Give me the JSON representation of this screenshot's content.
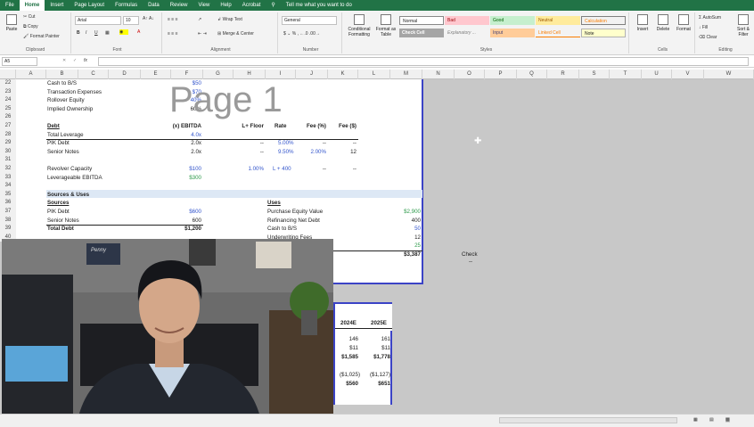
{
  "tabs": [
    "File",
    "Home",
    "Insert",
    "Page Layout",
    "Formulas",
    "Data",
    "Review",
    "View",
    "Help",
    "Acrobat",
    "Tell me what you want to do"
  ],
  "clipboard": {
    "paste": "Paste",
    "cut": "Cut",
    "copy": "Copy",
    "format_painter": "Format Painter",
    "label": "Clipboard"
  },
  "font": {
    "name": "Arial",
    "size": "10",
    "label": "Font"
  },
  "alignment": {
    "wrap": "Wrap Text",
    "merge": "Merge & Center",
    "label": "Alignment"
  },
  "number": {
    "format": "General",
    "label": "Number"
  },
  "styles": {
    "cond": "Conditional Formatting",
    "table": "Format as Table",
    "items": [
      "Normal",
      "Bad",
      "Good",
      "Neutral",
      "Calculation",
      "Check Cell",
      "Explanatory ...",
      "Input",
      "Linked Cell",
      "Note"
    ],
    "label": "Styles"
  },
  "cells": {
    "insert": "Insert",
    "delete": "Delete",
    "format": "Format",
    "label": "Cells"
  },
  "editing": {
    "autosum": "AutoSum",
    "fill": "Fill",
    "clear": "Clear",
    "sort": "Sort & Filter",
    "label": "Editing"
  },
  "formula_bar": {
    "cell": "A5",
    "fx": "fx"
  },
  "columns": [
    "A",
    "B",
    "C",
    "D",
    "E",
    "F",
    "G",
    "H",
    "I",
    "J",
    "K",
    "L",
    "M",
    "N",
    "O",
    "P",
    "Q",
    "R",
    "S",
    "T",
    "U",
    "V",
    "W"
  ],
  "rows": [
    "22",
    "23",
    "24",
    "25",
    "26",
    "27",
    "28",
    "29",
    "30",
    "31",
    "32",
    "33",
    "34",
    "35",
    "36",
    "37",
    "38",
    "39",
    "40"
  ],
  "watermark": "Page 1",
  "sheet": {
    "r22": {
      "b": "Cash to B/S",
      "f": "$50"
    },
    "r23": {
      "b": "Transaction Expenses",
      "f": "$70"
    },
    "r24": {
      "b": "Rollover Equity",
      "f": "40%"
    },
    "r25": {
      "b": "Implied Ownership",
      "f": "60%"
    },
    "r27": {
      "b": "Debt",
      "f": "(x) EBITDA",
      "h": "L+ Floor",
      "i": "Rate",
      "j": "Fee (%)",
      "k": "Fee ($)"
    },
    "r28": {
      "b": "Total Leverage",
      "f": "4.0x"
    },
    "r29": {
      "b": "PIK Debt",
      "f": "2.0x",
      "h": "--",
      "i": "5.00%",
      "j": "--",
      "k": "--"
    },
    "r30": {
      "b": "Senior Notes",
      "f": "2.0x",
      "h": "--",
      "i": "9.50%",
      "j": "2.00%",
      "k": "12"
    },
    "r32": {
      "b": "Revolver Capacity",
      "f": "$100",
      "h": "1.00%",
      "i": "L + 400",
      "j": "--",
      "k": "--"
    },
    "r33": {
      "b": "Leverageable EBITDA",
      "f": "$300"
    },
    "r35": {
      "b": "Sources & Uses"
    },
    "r36": {
      "b": "Sources",
      "i": "Uses"
    },
    "r37": {
      "b": "PIK Debt",
      "f": "$600",
      "i": "Purchase Equity Value",
      "m": "$2,900"
    },
    "r38": {
      "b": "Senior Notes",
      "f": "600",
      "i": "Refinancing Net Debt",
      "m": "400"
    },
    "r39": {
      "b": "Total Debt",
      "f": "$1,200",
      "i": "Cash to B/S",
      "m": "50"
    },
    "r40": {
      "i": "Underwriting Fees",
      "m": "12"
    },
    "r41": {
      "m": "25"
    },
    "r42": {
      "m": "$3,387"
    }
  },
  "check": {
    "label": "Check",
    "value": "--"
  },
  "page2": {
    "headers": [
      "2024E",
      "2025E"
    ],
    "rows": [
      [
        "146",
        "161"
      ],
      [
        "$11",
        "$11"
      ],
      [
        "$1,585",
        "$1,778"
      ],
      [
        "",
        ""
      ],
      [
        "($1,025)",
        "($1,127)"
      ],
      [
        "$560",
        "$651"
      ]
    ]
  },
  "video": {
    "poster_text": "Penny"
  }
}
